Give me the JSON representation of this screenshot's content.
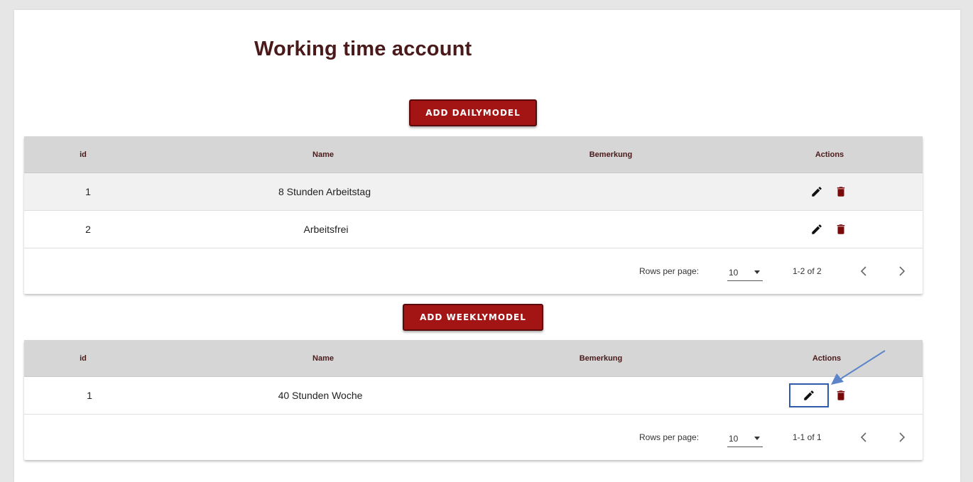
{
  "page": {
    "title": "Working time account"
  },
  "daily": {
    "add_button": "ADD DAILYMODEL",
    "columns": [
      "id",
      "Name",
      "Bemerkung",
      "Actions"
    ],
    "rows": [
      {
        "id": "1",
        "name": "8 Stunden Arbeitstag",
        "bemerkung": ""
      },
      {
        "id": "2",
        "name": "Arbeitsfrei",
        "bemerkung": ""
      }
    ],
    "pagination": {
      "rows_per_page_label": "Rows per page:",
      "rows_per_page": "10",
      "range": "1-2 of 2"
    }
  },
  "weekly": {
    "add_button": "ADD WEEKLYMODEL",
    "columns": [
      "id",
      "Name",
      "Bemerkung",
      "Actions"
    ],
    "rows": [
      {
        "id": "1",
        "name": "40 Stunden Woche",
        "bemerkung": ""
      }
    ],
    "pagination": {
      "rows_per_page_label": "Rows per page:",
      "rows_per_page": "10",
      "range": "1-1 of 1"
    }
  },
  "icons": {
    "edit": "pencil-icon",
    "delete": "trash-icon",
    "prev": "chevron-left-icon",
    "next": "chevron-right-icon",
    "dropdown": "caret-down-icon"
  },
  "colors": {
    "accent": "#a31515",
    "header_bg": "#d6d6d6",
    "title": "#4a1a1a",
    "highlight": "#2e5caa"
  }
}
